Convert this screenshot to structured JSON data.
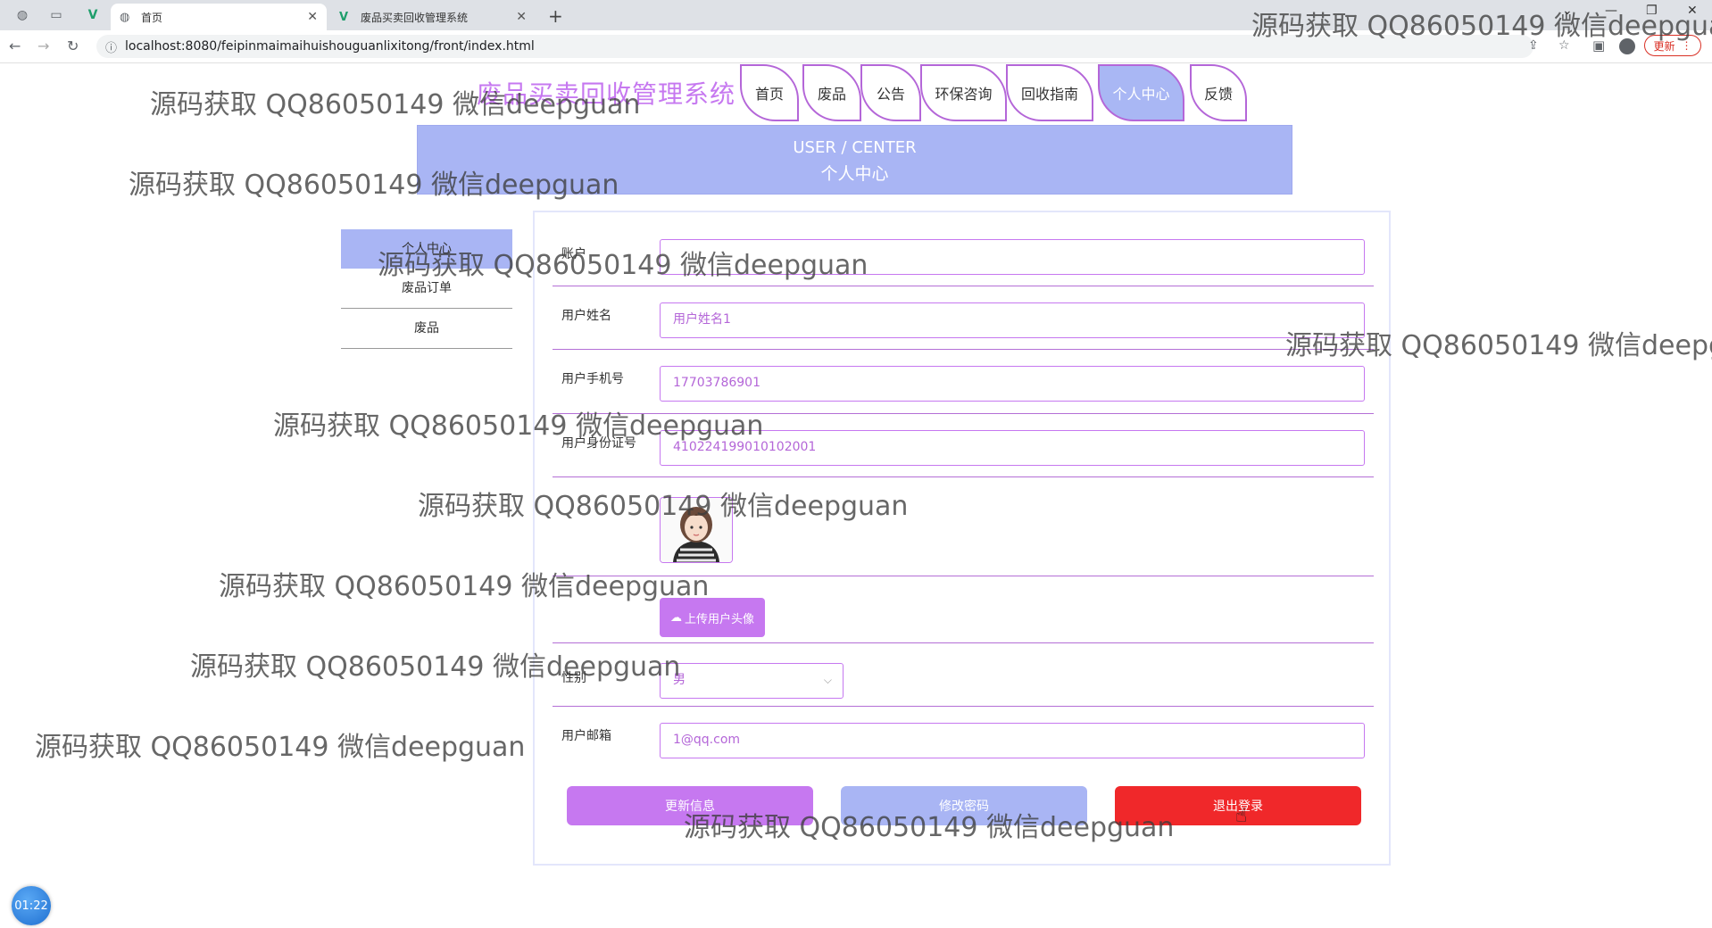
{
  "browser": {
    "tabs": [
      {
        "label": "首页",
        "close": "✕"
      },
      {
        "label": "废品买卖回收管理系统",
        "close": "✕"
      }
    ],
    "new_tab": "+",
    "url": "localhost:8080/feipinmaimaihuishouguanlixitong/front/index.html",
    "update_label": "更新",
    "window_controls": {
      "minimize": "—",
      "maximize": "❐",
      "close": "✕"
    }
  },
  "site": {
    "title": "废品买卖回收管理系统",
    "nav": [
      "首页",
      "废品",
      "公告",
      "环保咨询",
      "回收指南",
      "个人中心",
      "反馈"
    ],
    "active_nav": "个人中心"
  },
  "banner": {
    "en": "USER / CENTER",
    "cn": "个人中心"
  },
  "left_menu": [
    "个人中心",
    "废品订单",
    "废品"
  ],
  "form": {
    "account_label": "账户",
    "account_value": "",
    "name_label": "用户姓名",
    "name_value": "用户姓名1",
    "phone_label": "用户手机号",
    "phone_value": "17703786901",
    "idcard_label": "用户身份证号",
    "idcard_value": "410224199010102001",
    "upload_label": "上传用户头像",
    "gender_label": "性别",
    "gender_value": "男",
    "email_label": "用户邮箱",
    "email_value": "1@qq.com"
  },
  "buttons": {
    "update": "更新信息",
    "password": "修改密码",
    "logout": "退出登录"
  },
  "timer": "01:22",
  "watermark": "源码获取 QQ86050149 微信deepguan",
  "watermark_cut_a": "源码获取 QQ86050149 微信deepgua",
  "watermark_cut_b": "源码获取 QQ86050149 微信deepg",
  "colors": {
    "accent": "#c678f0",
    "banner": "#a9b5f4",
    "danger": "#f0282a"
  }
}
